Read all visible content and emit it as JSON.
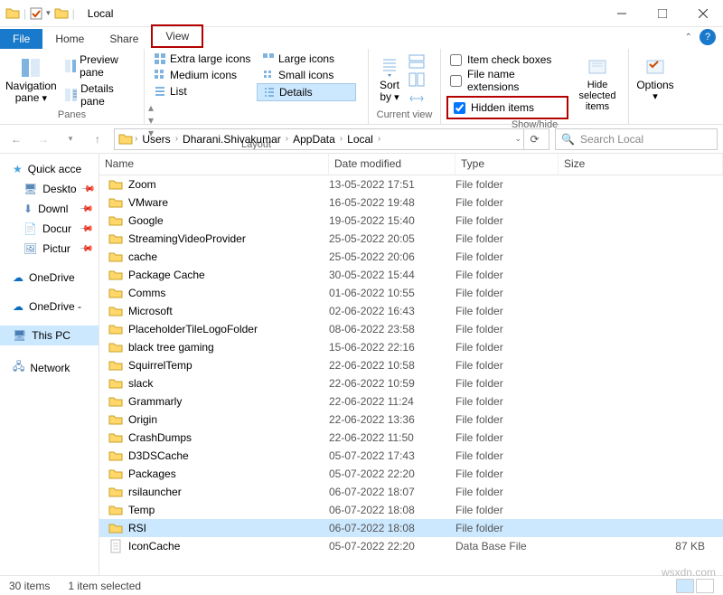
{
  "window": {
    "title": "Local"
  },
  "tabs": {
    "file": "File",
    "home": "Home",
    "share": "Share",
    "view": "View"
  },
  "ribbon": {
    "panes": {
      "nav": "Navigation pane",
      "preview": "Preview pane",
      "details": "Details pane",
      "group": "Panes"
    },
    "layout": {
      "xl": "Extra large icons",
      "l": "Large icons",
      "m": "Medium icons",
      "s": "Small icons",
      "list": "List",
      "details": "Details",
      "group": "Layout"
    },
    "cview": {
      "sort": "Sort by",
      "group": "Current view"
    },
    "showhide": {
      "itemcheck": "Item check boxes",
      "ext": "File name extensions",
      "hidden": "Hidden items",
      "hidesel": "Hide selected items",
      "group": "Show/hide"
    },
    "options": "Options"
  },
  "breadcrumb": [
    "Users",
    "Dharani.Shivakumar",
    "AppData",
    "Local"
  ],
  "search": {
    "placeholder": "Search Local"
  },
  "columns": {
    "name": "Name",
    "date": "Date modified",
    "type": "Type",
    "size": "Size"
  },
  "sidebar": {
    "quick": "Quick acce",
    "pinned": [
      "Deskto",
      "Downl",
      "Docur",
      "Pictur"
    ],
    "onedrive1": "OneDrive",
    "onedrive2": "OneDrive -",
    "thispc": "This PC",
    "network": "Network"
  },
  "files": [
    {
      "name": "Zoom",
      "date": "13-05-2022 17:51",
      "type": "File folder",
      "size": "",
      "icon": "folder"
    },
    {
      "name": "VMware",
      "date": "16-05-2022 19:48",
      "type": "File folder",
      "size": "",
      "icon": "folder"
    },
    {
      "name": "Google",
      "date": "19-05-2022 15:40",
      "type": "File folder",
      "size": "",
      "icon": "folder"
    },
    {
      "name": "StreamingVideoProvider",
      "date": "25-05-2022 20:05",
      "type": "File folder",
      "size": "",
      "icon": "folder"
    },
    {
      "name": "cache",
      "date": "25-05-2022 20:06",
      "type": "File folder",
      "size": "",
      "icon": "folder"
    },
    {
      "name": "Package Cache",
      "date": "30-05-2022 15:44",
      "type": "File folder",
      "size": "",
      "icon": "folder"
    },
    {
      "name": "Comms",
      "date": "01-06-2022 10:55",
      "type": "File folder",
      "size": "",
      "icon": "folder"
    },
    {
      "name": "Microsoft",
      "date": "02-06-2022 16:43",
      "type": "File folder",
      "size": "",
      "icon": "folder"
    },
    {
      "name": "PlaceholderTileLogoFolder",
      "date": "08-06-2022 23:58",
      "type": "File folder",
      "size": "",
      "icon": "folder"
    },
    {
      "name": "black tree gaming",
      "date": "15-06-2022 22:16",
      "type": "File folder",
      "size": "",
      "icon": "folder"
    },
    {
      "name": "SquirrelTemp",
      "date": "22-06-2022 10:58",
      "type": "File folder",
      "size": "",
      "icon": "folder"
    },
    {
      "name": "slack",
      "date": "22-06-2022 10:59",
      "type": "File folder",
      "size": "",
      "icon": "folder"
    },
    {
      "name": "Grammarly",
      "date": "22-06-2022 11:24",
      "type": "File folder",
      "size": "",
      "icon": "folder"
    },
    {
      "name": "Origin",
      "date": "22-06-2022 13:36",
      "type": "File folder",
      "size": "",
      "icon": "folder"
    },
    {
      "name": "CrashDumps",
      "date": "22-06-2022 11:50",
      "type": "File folder",
      "size": "",
      "icon": "folder"
    },
    {
      "name": "D3DSCache",
      "date": "05-07-2022 17:43",
      "type": "File folder",
      "size": "",
      "icon": "folder"
    },
    {
      "name": "Packages",
      "date": "05-07-2022 22:20",
      "type": "File folder",
      "size": "",
      "icon": "folder"
    },
    {
      "name": "rsilauncher",
      "date": "06-07-2022 18:07",
      "type": "File folder",
      "size": "",
      "icon": "folder"
    },
    {
      "name": "Temp",
      "date": "06-07-2022 18:08",
      "type": "File folder",
      "size": "",
      "icon": "folder"
    },
    {
      "name": "RSI",
      "date": "06-07-2022 18:08",
      "type": "File folder",
      "size": "",
      "icon": "folder",
      "selected": true
    },
    {
      "name": "IconCache",
      "date": "05-07-2022 22:20",
      "type": "Data Base File",
      "size": "87 KB",
      "icon": "file"
    }
  ],
  "status": {
    "count": "30 items",
    "sel": "1 item selected"
  },
  "watermark": "wsxdn.com"
}
